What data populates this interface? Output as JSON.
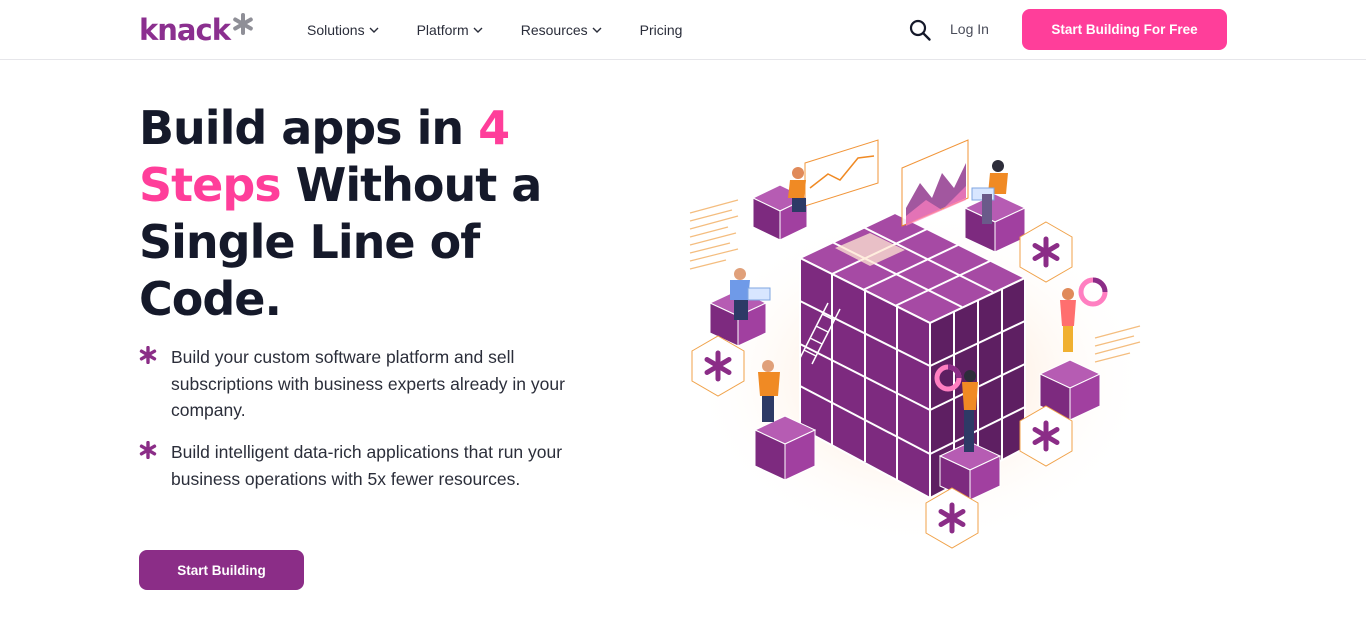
{
  "header": {
    "logo_text": "knack",
    "logo_icon": "asterisk-icon",
    "nav": [
      {
        "label": "Solutions",
        "has_dropdown": true
      },
      {
        "label": "Platform",
        "has_dropdown": true
      },
      {
        "label": "Resources",
        "has_dropdown": true
      },
      {
        "label": "Pricing",
        "has_dropdown": false
      }
    ],
    "search_icon": "search-icon",
    "login_label": "Log In",
    "cta_label": "Start Building For Free"
  },
  "hero": {
    "title_part1": "Build apps in ",
    "title_accent1": "4",
    "title_accent2": "Steps",
    "title_part2": " Without a Single Line of Code.",
    "bullets": [
      {
        "icon": "asterisk-icon",
        "text": "Build your custom software platform and sell subscriptions with business experts already in your company."
      },
      {
        "icon": "asterisk-icon",
        "text": "Build intelligent data-rich applications that run your business operations with 5x fewer resources."
      }
    ],
    "cta_label": "Start Building",
    "illustration": "isometric-cube-illustration"
  },
  "colors": {
    "brand_purple": "#8b2f8f",
    "accent_pink": "#ff3e9a",
    "button_purple": "#8b2d87",
    "cube_purple": "#7d2a7f",
    "orange": "#f08a24"
  }
}
